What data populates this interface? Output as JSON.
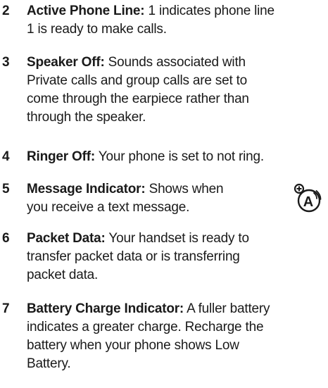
{
  "items": [
    {
      "number": "2",
      "term": "Active Phone Line:",
      "lines": [
        " 1 indicates phone line",
        "1 is ready to make calls."
      ]
    },
    {
      "number": "3",
      "term": "Speaker Off:",
      "lines": [
        " Sounds associated with",
        "Private calls and group calls are set to",
        "come through the earpiece rather than",
        "through the speaker."
      ]
    },
    {
      "number": "4",
      "term": "Ringer Off:",
      "lines": [
        " Your phone is set to not ring."
      ]
    },
    {
      "number": "5",
      "term": "Message Indicator:",
      "lines": [
        " Shows when",
        "you receive a text message."
      ]
    },
    {
      "number": "6",
      "term": "Packet Data:",
      "lines": [
        " Your handset is ready to",
        "transfer packet data or is transferring",
        "packet data."
      ]
    },
    {
      "number": "7",
      "term": "Battery Charge Indicator:",
      "lines": [
        " A fuller battery",
        "indicates a greater charge. Recharge the",
        "battery when your phone shows Low",
        "Battery."
      ]
    }
  ],
  "icon": {
    "name": "accessibility-speech-icon",
    "glyph": "A"
  }
}
